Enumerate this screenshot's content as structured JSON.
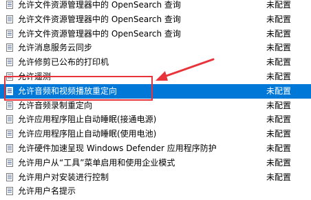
{
  "policies": [
    {
      "name": "允许文件资源管理器中的 OpenSearch 查询",
      "state": "未配置"
    },
    {
      "name": "允许文件资源管理器中的 OpenSearch 查询",
      "state": "未配置"
    },
    {
      "name": "允许文件资源管理器中的 OpenSearch 查询",
      "state": "未配置"
    },
    {
      "name": "允许消息服务云同步",
      "state": "未配置"
    },
    {
      "name": "允许修剪已公布的打印机",
      "state": "未配置"
    },
    {
      "name": "允许遥测",
      "state": "未配置"
    },
    {
      "name": "允许音频和视频播放重定向",
      "state": "未配置"
    },
    {
      "name": "允许音频录制重定向",
      "state": "未配置"
    },
    {
      "name": "允许应用程序阻止自动睡眠(接通电源)",
      "state": "未配置"
    },
    {
      "name": "允许应用程序阻止自动睡眠(使用电池)",
      "state": "未配置"
    },
    {
      "name": "允许硬件加速呈现 Windows Defender 应用程序防护",
      "state": "未配置"
    },
    {
      "name": "允许用户从“工具”菜单启用和使用企业模式",
      "state": "未配置"
    },
    {
      "name": "允许用户对安装进行控制",
      "state": "未配置"
    },
    {
      "name": "允许用户名提示",
      "state": ""
    }
  ],
  "colors": {
    "selection": "#0078d7",
    "annotation": "#e8333a"
  },
  "icon": "policy-setting-icon"
}
